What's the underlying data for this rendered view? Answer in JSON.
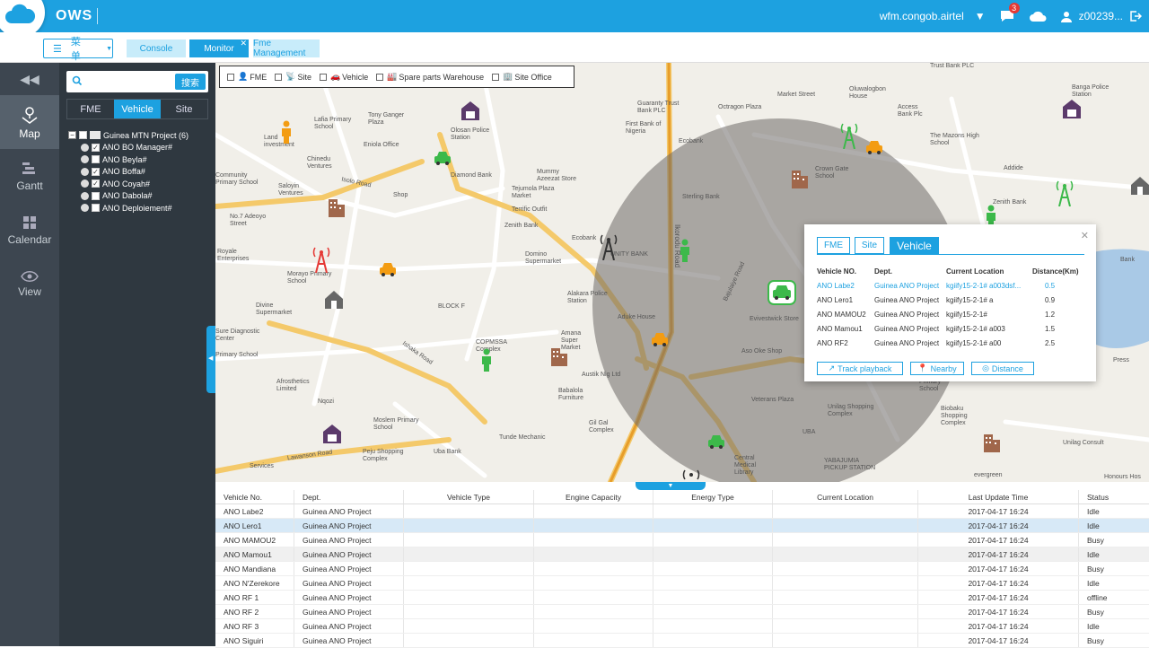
{
  "app": {
    "title": "OWS"
  },
  "top_right": {
    "domain": "wfm.congob.airtel",
    "notification_count": "3",
    "user": "z00239..."
  },
  "tabbar": {
    "menu_label": "菜单",
    "tabs": [
      {
        "label": "Console",
        "active": false
      },
      {
        "label": "Monitor",
        "active": true
      },
      {
        "label": "Fme Management",
        "active": false
      }
    ]
  },
  "leftnav": {
    "items": [
      {
        "label": "Map",
        "icon": "map-icon",
        "active": true
      },
      {
        "label": "Gantt",
        "icon": "gantt-icon",
        "active": false
      },
      {
        "label": "Calendar",
        "icon": "calendar-icon",
        "active": false
      },
      {
        "label": "View",
        "icon": "eye-icon",
        "active": false
      }
    ]
  },
  "sidepanel": {
    "search_placeholder": "",
    "search_button": "搜索",
    "tabs": [
      "FME",
      "Vehicle",
      "Site"
    ],
    "active_tab": "Vehicle",
    "tree": {
      "root": "Guinea MTN Project (6)",
      "children": [
        {
          "label": "ANO BO Manager#",
          "checked": true
        },
        {
          "label": "ANO Beyla#",
          "checked": false
        },
        {
          "label": "ANO Boffa#",
          "checked": true
        },
        {
          "label": "ANO Coyah#",
          "checked": true
        },
        {
          "label": "ANO Dabola#",
          "checked": false
        },
        {
          "label": "ANO Deploiement#",
          "checked": false
        }
      ]
    }
  },
  "map": {
    "filters": [
      {
        "label": "FME",
        "icon": "person-icon",
        "checked": true
      },
      {
        "label": "Site",
        "icon": "tower-icon",
        "checked": true
      },
      {
        "label": "Vehicle",
        "icon": "car-icon",
        "checked": true
      },
      {
        "label": "Spare parts Warehouse",
        "icon": "warehouse-icon",
        "checked": true
      },
      {
        "label": "Site Office",
        "icon": "office-icon",
        "checked": true
      }
    ],
    "labels": [
      "Land investment",
      "Tony Ganger Plaza",
      "Lafia Primary School",
      "Eniola Office",
      "Olosan Police Station",
      "Guaranty Trust Bank PLC",
      "First Bank of Nigeria",
      "Ecobank",
      "Octragon Plaza",
      "Market Street",
      "Oluwalogbon House",
      "Access Bank Plc",
      "Trust Bank PLC",
      "Banga Police Station",
      "The Mazons High School",
      "Chinedu Ventures",
      "Diamond Bank",
      "Mummy Azeezat Store",
      "Tejumola Plaza Market",
      "Terrific Outfit",
      "Zenith Bank",
      "Community Primary School",
      "Saloyin Ventures",
      "Isolo Road",
      "Shop",
      "No.7 Adeoyo Street",
      "Royale Enterprises",
      "Morayo Primary School",
      "Ecobank",
      "Domino Supermarket",
      "UNITY BANK",
      "Crown Gate School",
      "Sterling Bank",
      "Zenith Bank",
      "Addide",
      "Divine Supermarket",
      "Sure Diagnostic Center",
      "Primary School",
      "BLOCK F",
      "Alakara Police Station",
      "Aduke House",
      "COPMSSA Complex",
      "Amana Super Market",
      "Evivestwick Store",
      "Aso Oke Shop",
      "Ikorodu Road",
      "Bajulaiye Road",
      "Ishaka Road",
      "Austik Nig Ltd",
      "Babalola Furniture",
      "Afrosthetics Limited",
      "Nqozi",
      "Moslem Primary School",
      "Gil Gal Complex",
      "Veterans Plaza",
      "Unilag Shopping Complex",
      "UBA",
      "Tunde Mechanic",
      "Peju Shopping Complex",
      "Uba Bank",
      "Services",
      "Lawanson Road",
      "Central Medical Library",
      "YABAJUMIA PICKUP STATION",
      "Biobaku Shopping Complex",
      "Unilag Consult",
      "evergreen",
      "Honours Hos",
      "Primary School",
      "Press",
      "Bank"
    ]
  },
  "popup": {
    "tabs": [
      "FME",
      "Site",
      "Vehicle"
    ],
    "active_tab": "Vehicle",
    "columns": [
      "Vehicle NO.",
      "Dept.",
      "Current Location",
      "Distance(Km)"
    ],
    "rows": [
      {
        "no": "ANO Labe2",
        "dept": "Guinea ANO Project",
        "loc": "kgiify15-2-1# a003dsf...",
        "dist": "0.5",
        "highlight": true
      },
      {
        "no": "ANO Lero1",
        "dept": "Guinea ANO Project",
        "loc": "kgiify15-2-1# a",
        "dist": "0.9"
      },
      {
        "no": "ANO MAMOU2",
        "dept": "Guinea ANO Project",
        "loc": "kgiify15-2-1#",
        "dist": "1.2"
      },
      {
        "no": "ANO Mamou1",
        "dept": "Guinea ANO Project",
        "loc": "kgiify15-2-1# a003",
        "dist": "1.5"
      },
      {
        "no": "ANO RF2",
        "dept": "Guinea ANO Project",
        "loc": "kgiify15-2-1# a00",
        "dist": "2.5"
      }
    ],
    "buttons": [
      "Track playback",
      "Nearby",
      "Distance"
    ]
  },
  "table": {
    "columns": [
      "Vehicle No.",
      "Dept.",
      "Vehicle Type",
      "Engine Capacity",
      "Energy Type",
      "Current Location",
      "Last Update Time",
      "Status"
    ],
    "rows": [
      [
        "ANO Labe2",
        "Guinea ANO Project",
        "",
        "",
        "",
        "",
        "2017-04-17 16:24",
        "Idle"
      ],
      [
        "ANO Lero1",
        "Guinea ANO Project",
        "",
        "",
        "",
        "",
        "2017-04-17 16:24",
        "Idle"
      ],
      [
        "ANO MAMOU2",
        "Guinea ANO Project",
        "",
        "",
        "",
        "",
        "2017-04-17 16:24",
        "Busy"
      ],
      [
        "ANO Mamou1",
        "Guinea ANO Project",
        "",
        "",
        "",
        "",
        "2017-04-17 16:24",
        "Idle"
      ],
      [
        "ANO Mandiana",
        "Guinea ANO Project",
        "",
        "",
        "",
        "",
        "2017-04-17 16:24",
        "Busy"
      ],
      [
        "ANO N'Zerekore",
        "Guinea ANO Project",
        "",
        "",
        "",
        "",
        "2017-04-17 16:24",
        "Idle"
      ],
      [
        "ANO RF 1",
        "Guinea ANO Project",
        "",
        "",
        "",
        "",
        "2017-04-17 16:24",
        "offline"
      ],
      [
        "ANO RF 2",
        "Guinea ANO Project",
        "",
        "",
        "",
        "",
        "2017-04-17 16:24",
        "Busy"
      ],
      [
        "ANO RF 3",
        "Guinea ANO Project",
        "",
        "",
        "",
        "",
        "2017-04-17 16:24",
        "Idle"
      ],
      [
        "ANO Siguiri",
        "Guinea ANO Project",
        "",
        "",
        "",
        "",
        "2017-04-17 16:24",
        "Busy"
      ]
    ]
  },
  "colors": {
    "accent": "#1da1e0",
    "nav_bg": "#3d4650",
    "panel_bg": "#2f3840",
    "fme_orange": "#f39c12",
    "fme_green": "#3cb94a",
    "site_red": "#e53935"
  }
}
